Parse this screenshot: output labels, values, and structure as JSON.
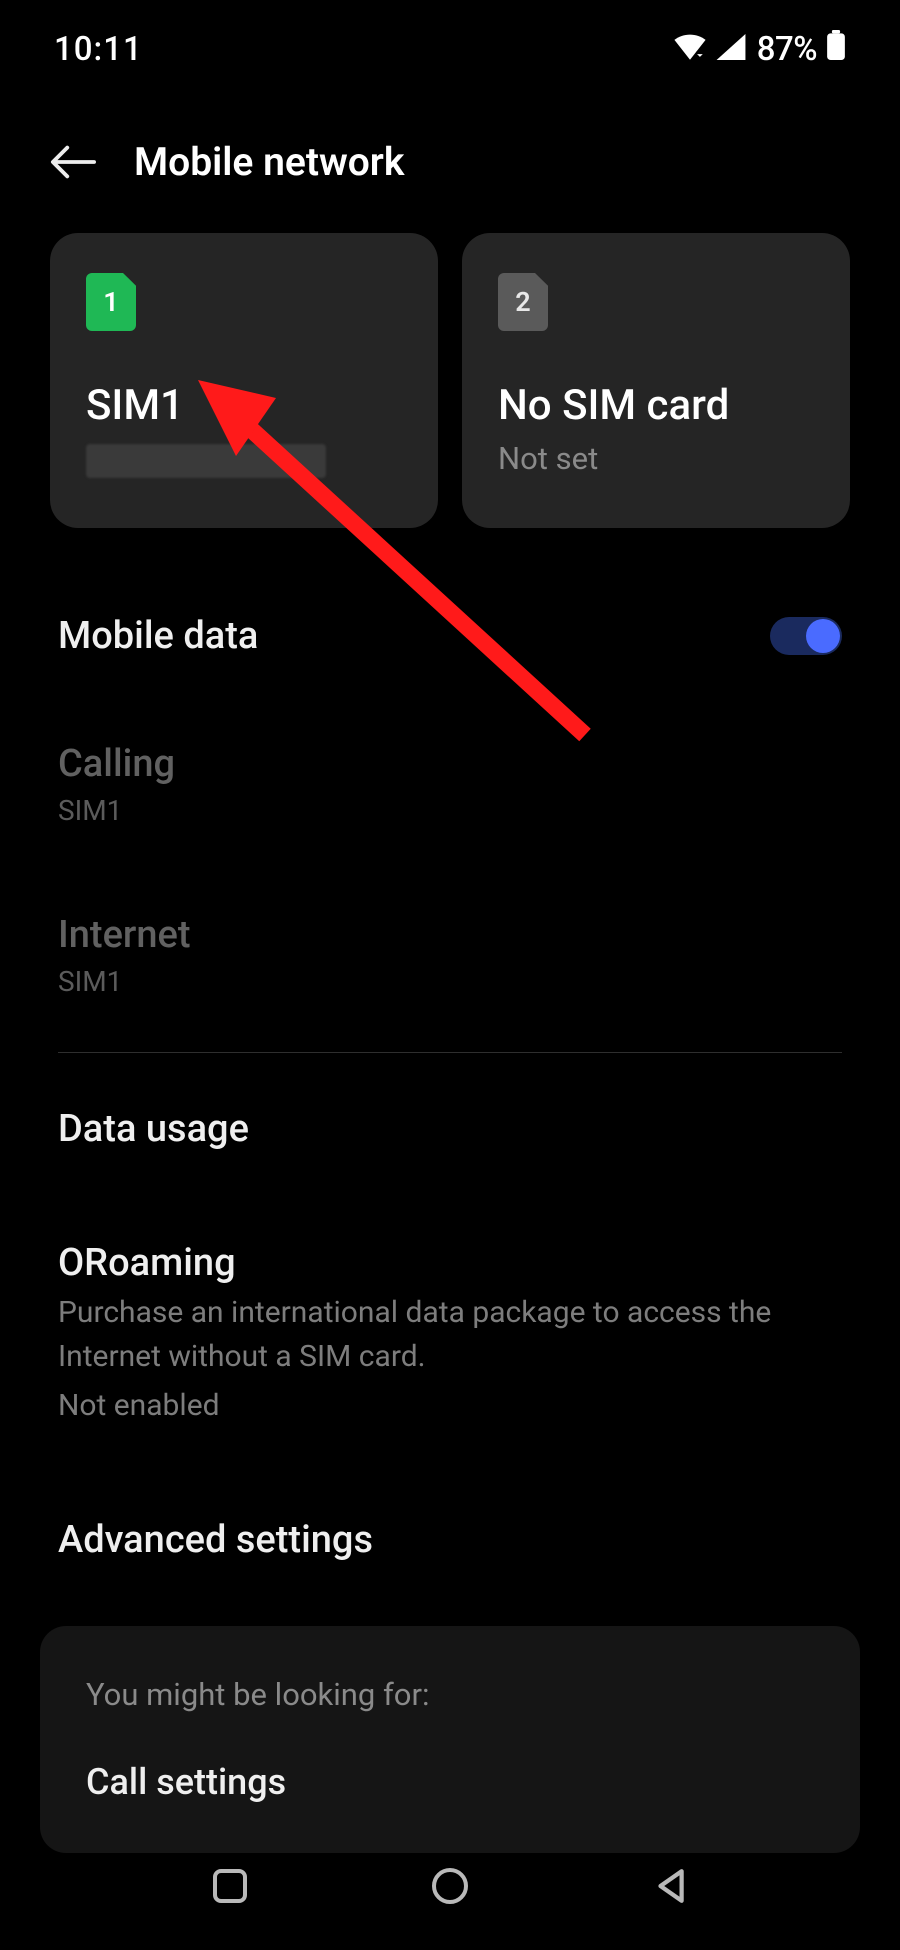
{
  "status_bar": {
    "time": "10:11",
    "battery": "87%"
  },
  "header": {
    "title": "Mobile network"
  },
  "sim_cards": [
    {
      "slot": "1",
      "name": "SIM1",
      "subtitle_redacted": true
    },
    {
      "slot": "2",
      "name": "No SIM card",
      "subtitle": "Not set"
    }
  ],
  "settings": {
    "mobile_data": {
      "label": "Mobile data",
      "enabled": true
    },
    "calling": {
      "label": "Calling",
      "value": "SIM1"
    },
    "internet": {
      "label": "Internet",
      "value": "SIM1"
    },
    "data_usage": {
      "label": "Data usage"
    },
    "oroaming": {
      "label": "ORoaming",
      "description": "Purchase an international data package to access the Internet without a SIM card.",
      "status": "Not enabled"
    },
    "advanced": {
      "label": "Advanced settings"
    }
  },
  "suggestion": {
    "heading": "You might be looking for:",
    "item": "Call settings"
  },
  "annotation": {
    "arrow_color": "#ff1a1a"
  }
}
